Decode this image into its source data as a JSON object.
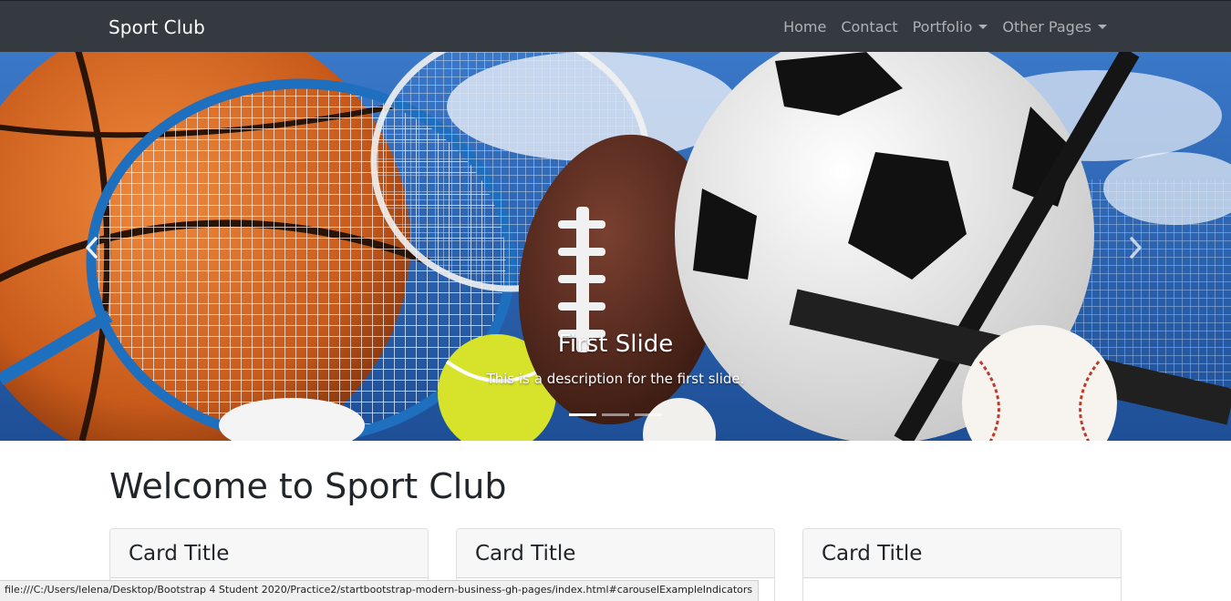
{
  "navbar": {
    "brand": "Sport Club",
    "links": [
      {
        "label": "Home"
      },
      {
        "label": "Contact"
      },
      {
        "label": "Portfolio"
      },
      {
        "label": "Other Pages"
      }
    ]
  },
  "carousel": {
    "slide_title": "First Slide",
    "slide_description": "This is a description for the first slide.",
    "indicator_count": 3,
    "active_index": 0
  },
  "main": {
    "heading": "Welcome to Sport Club",
    "cards": [
      {
        "title": "Card Title"
      },
      {
        "title": "Card Title"
      },
      {
        "title": "Card Title"
      }
    ]
  },
  "status_bar": {
    "url": "file:///C:/Users/lelena/Desktop/Bootstrap 4 Student 2020/Practice2/startbootstrap-modern-business-gh-pages/index.html#carouselExampleIndicators"
  },
  "colors": {
    "navbar_bg": "#343a40",
    "card_header_bg": "#f7f7f7"
  }
}
